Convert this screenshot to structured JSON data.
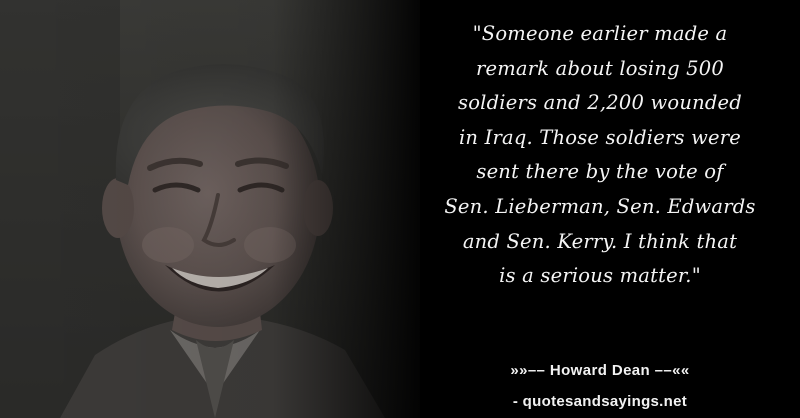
{
  "quote": {
    "lines": [
      "\"Someone earlier made a",
      "remark about losing 500",
      "soldiers and 2,200 wounded",
      "in Iraq. Those soldiers were",
      "sent there by the vote of",
      "Sen. Lieberman, Sen. Edwards",
      "and Sen. Kerry. I think that",
      "is a serious matter.\""
    ]
  },
  "attribution": "»»–– Howard Dean ––««",
  "site": "- quotesandsayings.net",
  "colors": {
    "background": "#000000",
    "text": "#f4f4f4"
  }
}
